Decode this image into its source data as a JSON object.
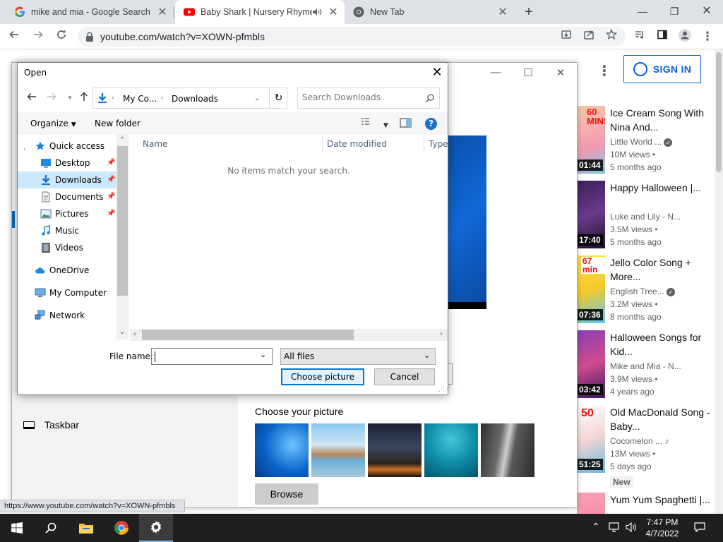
{
  "browser": {
    "tabs": [
      {
        "title": "mike and mia - Google Search",
        "favicon": "google-g-icon"
      },
      {
        "title": "Baby Shark | Nursery Rhymes",
        "favicon": "youtube-icon",
        "audio": "speaker-icon"
      },
      {
        "title": "New Tab",
        "favicon": "chrome-icon"
      }
    ],
    "tab_close": "✕",
    "new_tab": "+",
    "window_controls": {
      "minimize": "—",
      "restore": "❐",
      "close": "✕"
    },
    "url": "youtube.com/watch?v=XOWN-pfmbls",
    "status_url": "https://www.youtube.com/watch?v=XOWN-pfmbls"
  },
  "youtube": {
    "sign_in": "SIGN IN",
    "more": "⋮",
    "recommendations": [
      {
        "title": "Ice Cream Song With Nina And...",
        "channel": "Little World ...",
        "verified": true,
        "views": "10M views •",
        "age": "5 months ago",
        "duration": "01:44",
        "badge": "60 MINS"
      },
      {
        "title": "Happy Halloween |...",
        "channel": "Luke and Lily - N...",
        "verified": false,
        "views": "3.5M views •",
        "age": "5 months ago",
        "duration": "17:40"
      },
      {
        "title": "Jello Color Song + More...",
        "channel": "English Tree...",
        "verified": true,
        "views": "3.2M views •",
        "age": "8 months ago",
        "duration": "07:36",
        "badge": "67 min"
      },
      {
        "title": "Halloween Songs for Kid...",
        "channel": "Mike and Mia - N...",
        "verified": false,
        "views": "3.9M views •",
        "age": "4 years ago",
        "duration": "03:42"
      },
      {
        "title": "Old MacDonald Song - Baby...",
        "channel": "Cocomelon ...",
        "verified": false,
        "music": true,
        "views": "13M views •",
        "age": "5 days ago",
        "duration": "51:25",
        "badge": "50",
        "new_badge": "New"
      },
      {
        "title": "Yum Yum Spaghetti |...",
        "channel": "",
        "views": "",
        "age": "",
        "duration": ""
      }
    ]
  },
  "settings": {
    "taskbar_label": "Taskbar",
    "choose_picture_label": "Choose your picture",
    "browse_label": "Browse",
    "controls": {
      "minimize": "—",
      "maximize": "☐",
      "close": "✕"
    }
  },
  "dialog": {
    "title": "Open",
    "close": "✕",
    "breadcrumb": [
      "My Co...",
      "Downloads"
    ],
    "search_placeholder": "Search Downloads",
    "organize": "Organize",
    "new_folder": "New folder",
    "help": "?",
    "nav": [
      {
        "label": "Quick access",
        "icon": "star-icon"
      },
      {
        "label": "Desktop",
        "icon": "desktop-icon",
        "pinned": true
      },
      {
        "label": "Downloads",
        "icon": "download-arrow-icon",
        "pinned": true,
        "selected": true
      },
      {
        "label": "Documents",
        "icon": "document-icon",
        "pinned": true
      },
      {
        "label": "Pictures",
        "icon": "picture-icon",
        "pinned": true
      },
      {
        "label": "Music",
        "icon": "music-note-icon"
      },
      {
        "label": "Videos",
        "icon": "film-icon"
      },
      {
        "label": "OneDrive",
        "icon": "cloud-icon"
      },
      {
        "label": "My Computer",
        "icon": "computer-icon"
      },
      {
        "label": "Network",
        "icon": "network-icon"
      }
    ],
    "columns": [
      "Name",
      "Date modified",
      "Type"
    ],
    "empty_message": "No items match your search.",
    "file_name_label": "File name:",
    "file_name_value": "",
    "filter": "All files",
    "choose_button": "Choose picture",
    "cancel_button": "Cancel"
  },
  "taskbar": {
    "clock_time": "7:47 PM",
    "clock_date": "4/7/2022"
  },
  "colors": {
    "youtube_blue": "#065fd4",
    "windows_accent": "#0067c0",
    "selection": "#cce8ff"
  }
}
